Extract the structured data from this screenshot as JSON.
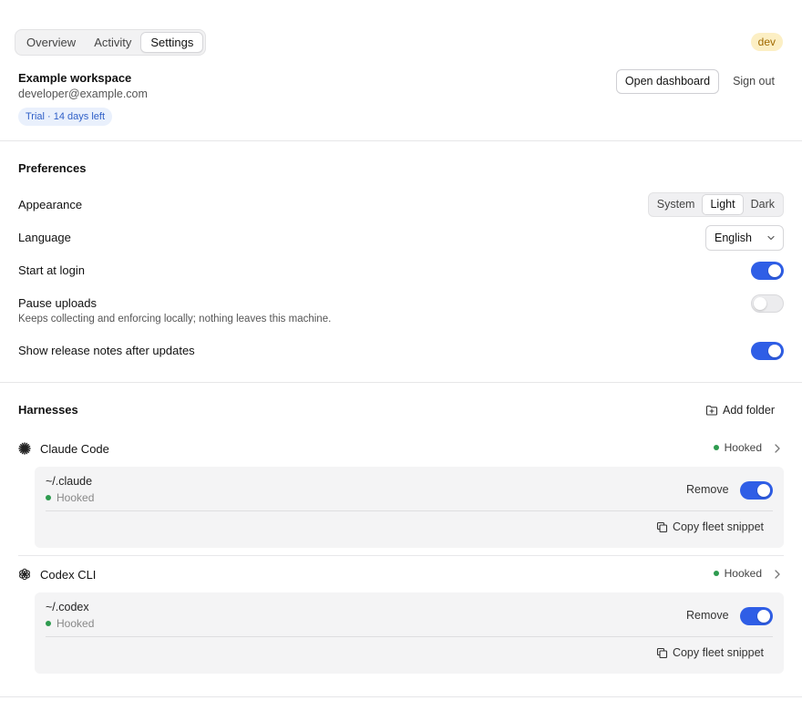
{
  "tabs": [
    {
      "label": "Overview",
      "active": false
    },
    {
      "label": "Activity",
      "active": false
    },
    {
      "label": "Settings",
      "active": true
    }
  ],
  "env_badge": "dev",
  "workspace": {
    "name": "Example workspace",
    "email": "developer@example.com",
    "trial": "Trial · 14 days left"
  },
  "header_actions": {
    "open_dashboard": "Open dashboard",
    "sign_out": "Sign out"
  },
  "preferences": {
    "title": "Preferences",
    "appearance": {
      "label": "Appearance",
      "options": [
        "System",
        "Light",
        "Dark"
      ],
      "selected": "Light"
    },
    "language": {
      "label": "Language",
      "value": "English"
    },
    "start_at_login": {
      "label": "Start at login",
      "on": true
    },
    "pause_uploads": {
      "label": "Pause uploads",
      "description": "Keeps collecting and enforcing locally; nothing leaves this machine.",
      "on": false
    },
    "release_notes": {
      "label": "Show release notes after updates",
      "on": true
    }
  },
  "harnesses": {
    "title": "Harnesses",
    "add_folder": "Add folder",
    "items": [
      {
        "name": "Claude Code",
        "icon": "asterisk-burst-icon",
        "status": "Hooked",
        "folder": {
          "path": "~/.claude",
          "status": "Hooked",
          "remove": "Remove",
          "enabled": true,
          "copy": "Copy fleet snippet"
        }
      },
      {
        "name": "Codex CLI",
        "icon": "knot-logo-icon",
        "status": "Hooked",
        "folder": {
          "path": "~/.codex",
          "status": "Hooked",
          "remove": "Remove",
          "enabled": true,
          "copy": "Copy fleet snippet"
        }
      }
    ]
  },
  "colors": {
    "accent": "#2f5ee6",
    "status_ok": "#2e9b4f",
    "dev_badge_bg": "#fcefc4",
    "dev_badge_fg": "#a06a00",
    "trial_bg": "#e9f0fc",
    "trial_fg": "#2f5fc7"
  }
}
